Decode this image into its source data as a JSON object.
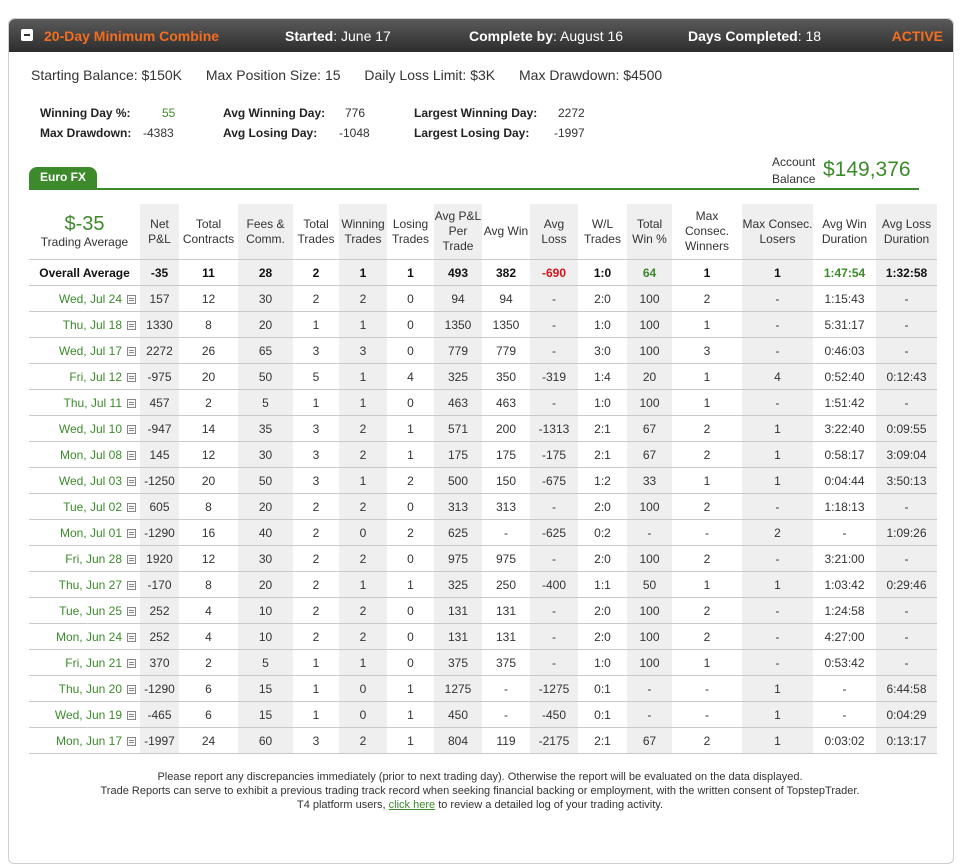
{
  "header": {
    "title": "20-Day Minimum Combine",
    "started_label": "Started",
    "started_value": "June 17",
    "complete_label": "Complete by",
    "complete_value": "August 16",
    "days_label": "Days Completed",
    "days_value": "18",
    "status": "ACTIVE"
  },
  "rules": {
    "starting_balance": "Starting Balance: $150K",
    "max_position": "Max Position Size: 15",
    "daily_loss": "Daily Loss Limit: $3K",
    "max_drawdown": "Max Drawdown: $4500"
  },
  "stats": {
    "winning_day_label": "Winning Day %:",
    "winning_day_value": "55",
    "max_drawdown_label": "Max Drawdown:",
    "max_drawdown_value": "-4383",
    "avg_winning_label": "Avg Winning Day:",
    "avg_winning_value": "776",
    "avg_losing_label": "Avg Losing Day:",
    "avg_losing_value": "-1048",
    "largest_winning_label": "Largest Winning Day:",
    "largest_winning_value": "2272",
    "largest_losing_label": "Largest Losing Day:",
    "largest_losing_value": "-1997"
  },
  "tab": {
    "label": "Euro FX"
  },
  "account": {
    "label_line1": "Account",
    "label_line2": "Balance",
    "value": "$149,376"
  },
  "summary": {
    "avg_value": "$-35",
    "avg_label": "Trading Average"
  },
  "columns": [
    "Net P&L",
    "Total Contracts",
    "Fees & Comm.",
    "Total Trades",
    "Winning Trades",
    "Losing Trades",
    "Avg P&L Per Trade",
    "Avg Win",
    "Avg Loss",
    "W/L Trades",
    "Total Win %",
    "Max Consec. Winners",
    "Max Consec. Losers",
    "Avg Win Duration",
    "Avg Loss Duration"
  ],
  "overall": {
    "label": "Overall Average",
    "values": [
      "-35",
      "11",
      "28",
      "2",
      "1",
      "1",
      "493",
      "382",
      "-690",
      "1:0",
      "64",
      "1",
      "1",
      "1:47:54",
      "1:32:58"
    ]
  },
  "rows": [
    {
      "date": "Wed, Jul 24",
      "values": [
        "157",
        "12",
        "30",
        "2",
        "2",
        "0",
        "94",
        "94",
        "-",
        "2:0",
        "100",
        "2",
        "-",
        "1:15:43",
        "-"
      ]
    },
    {
      "date": "Thu, Jul 18",
      "values": [
        "1330",
        "8",
        "20",
        "1",
        "1",
        "0",
        "1350",
        "1350",
        "-",
        "1:0",
        "100",
        "1",
        "-",
        "5:31:17",
        "-"
      ]
    },
    {
      "date": "Wed, Jul 17",
      "values": [
        "2272",
        "26",
        "65",
        "3",
        "3",
        "0",
        "779",
        "779",
        "-",
        "3:0",
        "100",
        "3",
        "-",
        "0:46:03",
        "-"
      ]
    },
    {
      "date": "Fri, Jul 12",
      "values": [
        "-975",
        "20",
        "50",
        "5",
        "1",
        "4",
        "325",
        "350",
        "-319",
        "1:4",
        "20",
        "1",
        "4",
        "0:52:40",
        "0:12:43"
      ]
    },
    {
      "date": "Thu, Jul 11",
      "values": [
        "457",
        "2",
        "5",
        "1",
        "1",
        "0",
        "463",
        "463",
        "-",
        "1:0",
        "100",
        "1",
        "-",
        "1:51:42",
        "-"
      ]
    },
    {
      "date": "Wed, Jul 10",
      "values": [
        "-947",
        "14",
        "35",
        "3",
        "2",
        "1",
        "571",
        "200",
        "-1313",
        "2:1",
        "67",
        "2",
        "1",
        "3:22:40",
        "0:09:55"
      ]
    },
    {
      "date": "Mon, Jul 08",
      "values": [
        "145",
        "12",
        "30",
        "3",
        "2",
        "1",
        "175",
        "175",
        "-175",
        "2:1",
        "67",
        "2",
        "1",
        "0:58:17",
        "3:09:04"
      ]
    },
    {
      "date": "Wed, Jul 03",
      "values": [
        "-1250",
        "20",
        "50",
        "3",
        "1",
        "2",
        "500",
        "150",
        "-675",
        "1:2",
        "33",
        "1",
        "1",
        "0:04:44",
        "3:50:13"
      ]
    },
    {
      "date": "Tue, Jul 02",
      "values": [
        "605",
        "8",
        "20",
        "2",
        "2",
        "0",
        "313",
        "313",
        "-",
        "2:0",
        "100",
        "2",
        "-",
        "1:18:13",
        "-"
      ]
    },
    {
      "date": "Mon, Jul 01",
      "values": [
        "-1290",
        "16",
        "40",
        "2",
        "0",
        "2",
        "625",
        "-",
        "-625",
        "0:2",
        "-",
        "-",
        "2",
        "-",
        "1:09:26"
      ]
    },
    {
      "date": "Fri, Jun 28",
      "values": [
        "1920",
        "12",
        "30",
        "2",
        "2",
        "0",
        "975",
        "975",
        "-",
        "2:0",
        "100",
        "2",
        "-",
        "3:21:00",
        "-"
      ]
    },
    {
      "date": "Thu, Jun 27",
      "values": [
        "-170",
        "8",
        "20",
        "2",
        "1",
        "1",
        "325",
        "250",
        "-400",
        "1:1",
        "50",
        "1",
        "1",
        "1:03:42",
        "0:29:46"
      ]
    },
    {
      "date": "Tue, Jun 25",
      "values": [
        "252",
        "4",
        "10",
        "2",
        "2",
        "0",
        "131",
        "131",
        "-",
        "2:0",
        "100",
        "2",
        "-",
        "1:24:58",
        "-"
      ]
    },
    {
      "date": "Mon, Jun 24",
      "values": [
        "252",
        "4",
        "10",
        "2",
        "2",
        "0",
        "131",
        "131",
        "-",
        "2:0",
        "100",
        "2",
        "-",
        "4:27:00",
        "-"
      ]
    },
    {
      "date": "Fri, Jun 21",
      "values": [
        "370",
        "2",
        "5",
        "1",
        "1",
        "0",
        "375",
        "375",
        "-",
        "1:0",
        "100",
        "1",
        "-",
        "0:53:42",
        "-"
      ]
    },
    {
      "date": "Thu, Jun 20",
      "values": [
        "-1290",
        "6",
        "15",
        "1",
        "0",
        "1",
        "1275",
        "-",
        "-1275",
        "0:1",
        "-",
        "-",
        "1",
        "-",
        "6:44:58"
      ]
    },
    {
      "date": "Wed, Jun 19",
      "values": [
        "-465",
        "6",
        "15",
        "1",
        "0",
        "1",
        "450",
        "-",
        "-450",
        "0:1",
        "-",
        "-",
        "1",
        "-",
        "0:04:29"
      ]
    },
    {
      "date": "Mon, Jun 17",
      "values": [
        "-1997",
        "24",
        "60",
        "3",
        "2",
        "1",
        "804",
        "119",
        "-2175",
        "2:1",
        "67",
        "2",
        "1",
        "0:03:02",
        "0:13:17"
      ]
    }
  ],
  "footer": {
    "line1": "Please report any discrepancies immediately (prior to next trading day). Otherwise the report will be evaluated on the data displayed.",
    "line2": "Trade Reports can serve to exhibit a previous trading track record when seeking financial backing or employment, with the written consent of TopstepTrader.",
    "line3_pre": "T4 platform users,",
    "line3_link": "click here",
    "line3_post": "to review a detailed log of your trading activity."
  },
  "colors": {
    "accent_orange": "#f36d21",
    "green": "#3c8a2c",
    "red": "#d4141b"
  }
}
